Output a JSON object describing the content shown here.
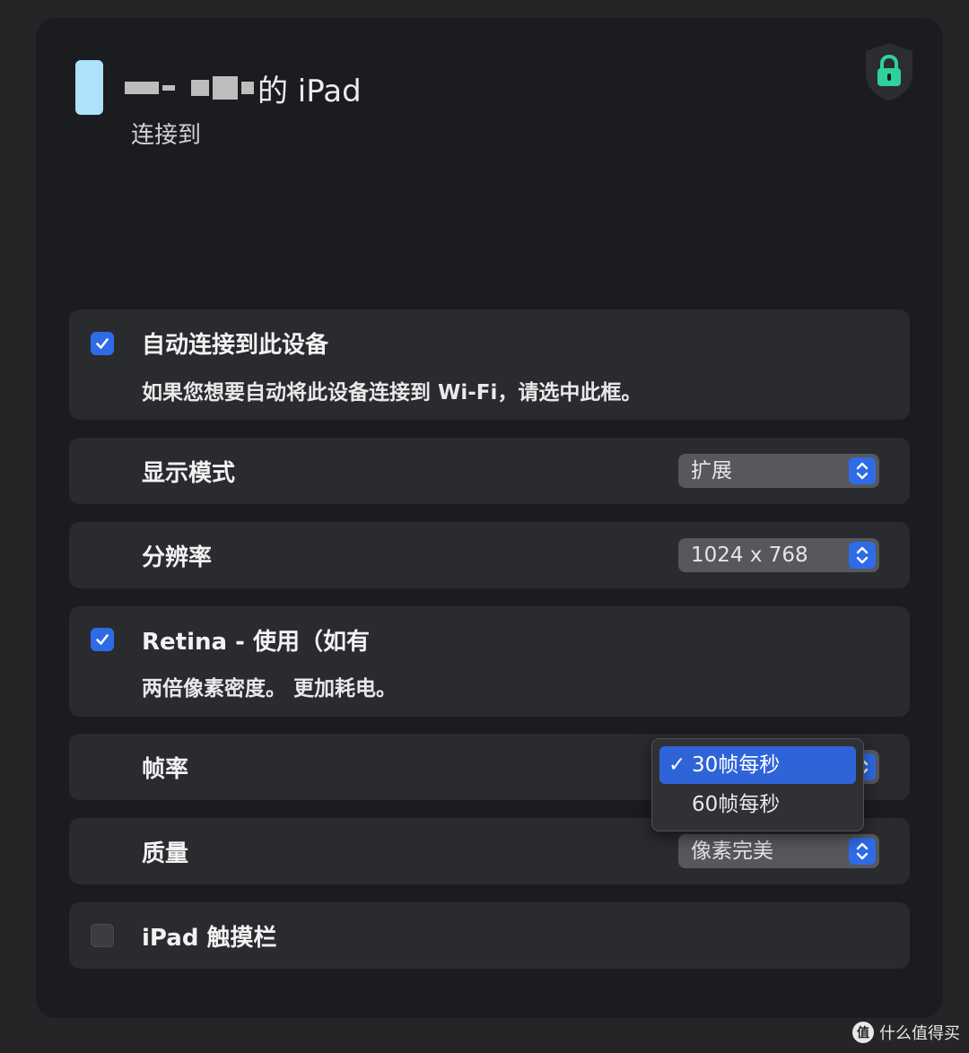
{
  "device": {
    "name_visible": "的 iPad",
    "status": "连接到"
  },
  "settings": {
    "auto_connect": {
      "label": "自动连接到此设备",
      "description": "如果您想要自动将此设备连接到 Wi-Fi，请选中此框。",
      "checked": true
    },
    "display_mode": {
      "label": "显示模式",
      "value": "扩展"
    },
    "resolution": {
      "label": "分辨率",
      "value": "1024 x 768"
    },
    "retina": {
      "label": "Retina - 使用（如有",
      "description": "两倍像素密度。 更加耗电。",
      "checked": true
    },
    "frame_rate": {
      "label": "帧率",
      "options": [
        {
          "label": "30帧每秒",
          "selected": true
        },
        {
          "label": "60帧每秒",
          "selected": false
        }
      ]
    },
    "quality": {
      "label": "质量",
      "value": "像素完美"
    },
    "touch_bar": {
      "label": "iPad 触摸栏",
      "checked": false
    }
  },
  "watermark": {
    "logo": "值",
    "text": "什么值得买"
  },
  "colors": {
    "accent": "#2f6be6",
    "lock": "#2fd19a",
    "device_icon": "#aee2fb"
  }
}
